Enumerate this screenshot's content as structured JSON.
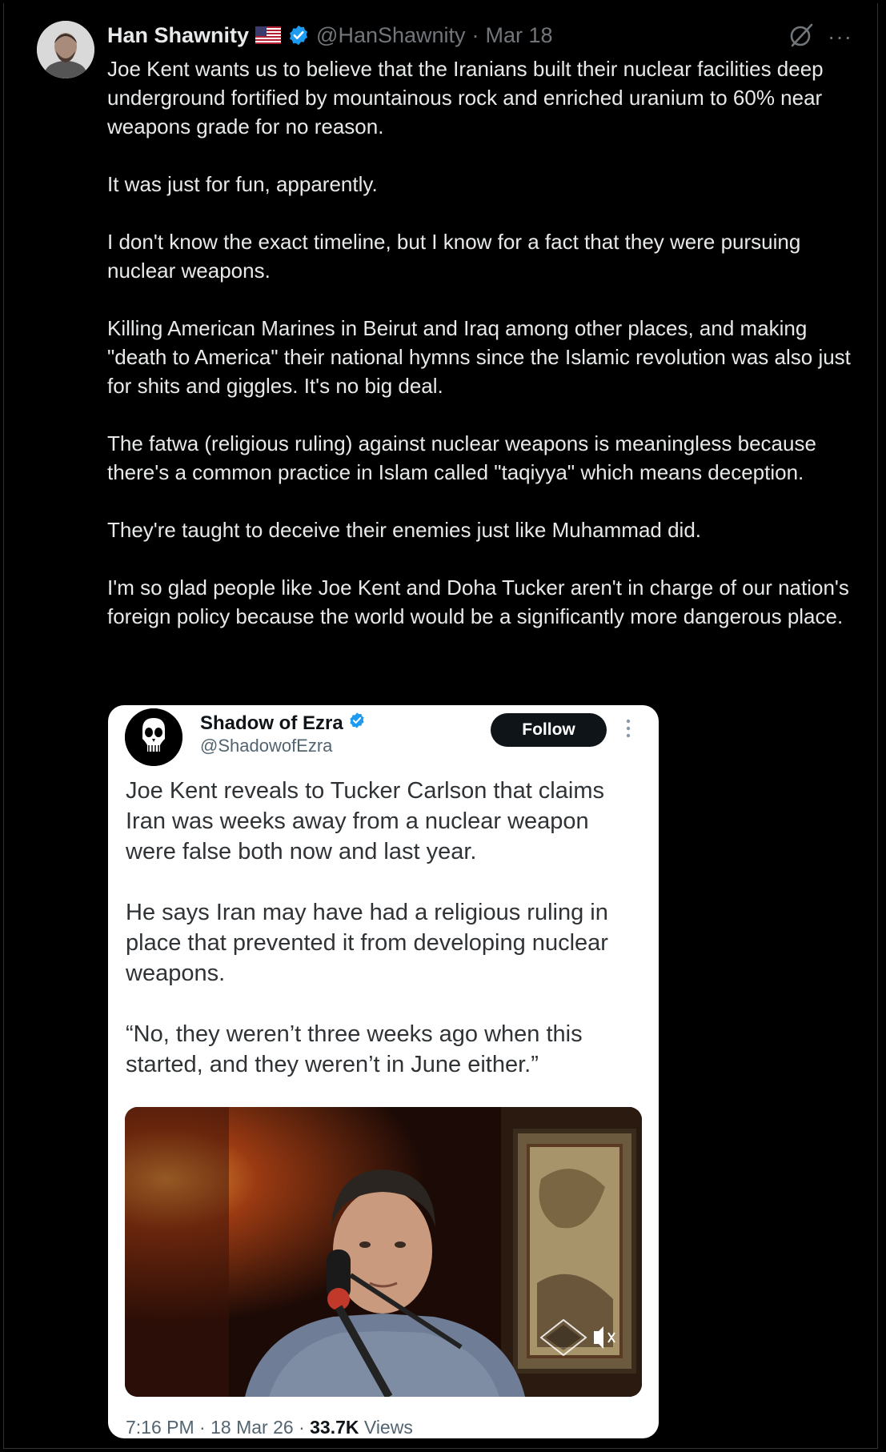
{
  "tweet": {
    "author_name": "Han Shawnity",
    "handle": "@HanShawnity",
    "separator": "·",
    "date": "Mar 18",
    "more_label": "···",
    "paragraphs": [
      "Joe Kent wants us to believe that the Iranians built their nuclear facilities deep underground fortified by mountainous rock and enriched uranium to 60% near weapons grade for no reason.",
      "It was just for fun, apparently.",
      "I don't know the exact timeline, but I know for a fact that they were pursuing nuclear weapons.",
      "Killing American Marines in Beirut and Iraq among other places, and making \"death to America\" their national hymns since the Islamic revolution was also just for shits and giggles. It's no big deal.",
      "The fatwa (religious ruling) against nuclear weapons is meaningless because there's a common practice in Islam called \"taqiyya\" which means deception.",
      "They're taught to deceive their enemies just like Muhammad did.",
      "I'm so glad people like Joe Kent and Doha Tucker aren't in charge of our nation's foreign policy because the world would be a significantly more dangerous place."
    ]
  },
  "quoted": {
    "author_name": "Shadow of Ezra",
    "handle": "@ShadowofEzra",
    "follow_label": "Follow",
    "paragraphs": [
      "Joe Kent reveals to Tucker Carlson that claims Iran was weeks away from a nuclear weapon were false both now and last year.",
      "He says Iran may have had a religious ruling in place that prevented it from developing nuclear weapons.",
      "“No, they weren’t three weeks ago when this started, and they weren’t in June either.”"
    ],
    "time": "7:16 PM",
    "sep": "·",
    "date": "18 Mar 26",
    "views_count": "33.7K",
    "views_label": "Views"
  },
  "colors": {
    "background": "#000000",
    "verified": "#1d9bf0",
    "muted": "#71767b",
    "card_bg": "#ffffff"
  },
  "icons": {
    "verified": "verified-badge-icon",
    "flag": "us-flag-icon",
    "grok": "grok-icon",
    "more": "more-icon"
  }
}
